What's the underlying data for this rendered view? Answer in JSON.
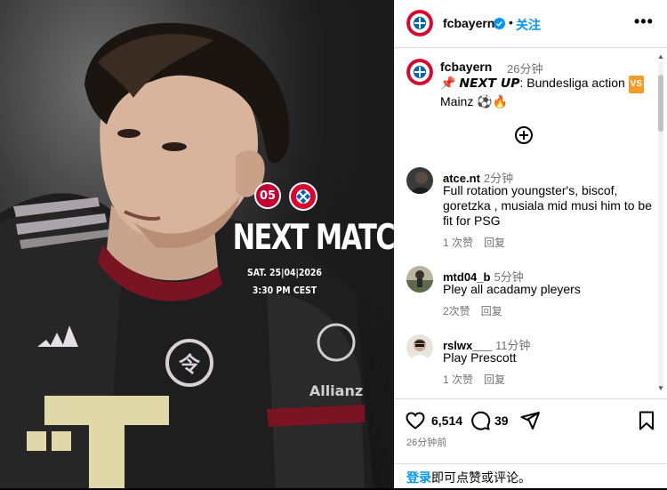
{
  "media": {
    "title": "NEXT MATCH",
    "date": "SAT. 25|04|2026",
    "time": "3:30 PM CEST",
    "mainz_crest_text": "05"
  },
  "header": {
    "username": "fcbayern",
    "dot": "•",
    "follow_label": "关注",
    "more_label": "•••"
  },
  "caption": {
    "username": "fcbayern",
    "time": "26分钟",
    "pin_emoji": "📌",
    "bold_text": "𝙉𝙀𝙓𝙏 𝙐𝙋",
    "text_after": ": Bundesliga action ",
    "vs_label": "VS",
    "text_line2": "Mainz ⚽🔥"
  },
  "comments": [
    {
      "username": "atce.nt",
      "time": "2分钟",
      "text": "Full rotation youngster's, biscof, goretzka , musiala mid musi him to be fit for PSG",
      "likes": "1 次赞",
      "reply": "回复"
    },
    {
      "username": "mtd04_b",
      "time": "5分钟",
      "text": "Pley all acadamy pleyers",
      "likes": "2次赞",
      "reply": "回复"
    },
    {
      "username": "rslwx___",
      "time": "11分钟",
      "text": "Play Prescott",
      "likes": "1 次赞",
      "reply": "回复"
    }
  ],
  "actions": {
    "likes": "6,514",
    "comments": "39",
    "ago": "26分钟前"
  },
  "footer": {
    "login_link": "登录",
    "login_text": "即可点赞或评论。"
  },
  "colors": {
    "link": "#0095f6",
    "bayern_red": "#dc052d",
    "mainz_red": "#c3002f"
  }
}
